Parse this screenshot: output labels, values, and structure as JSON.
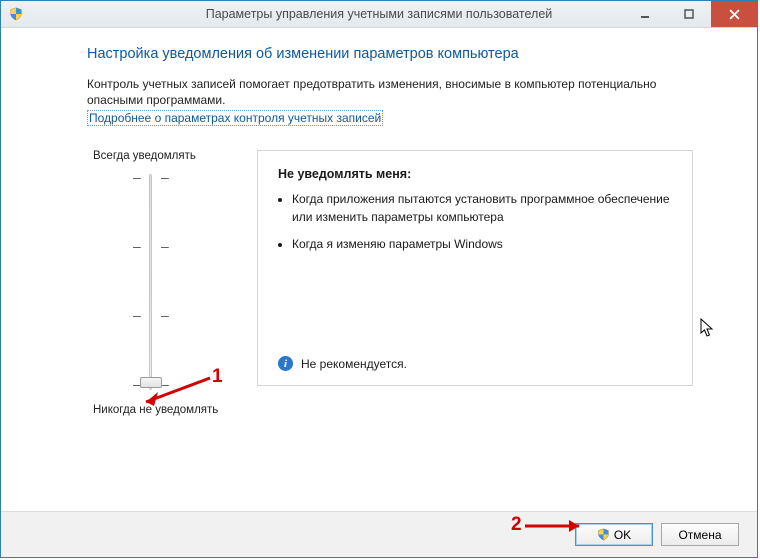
{
  "window": {
    "title": "Параметры управления учетными записями пользователей"
  },
  "heading": "Настройка уведомления об изменении параметров компьютера",
  "description": "Контроль учетных записей помогает предотвратить изменения, вносимые в компьютер потенциально опасными программами.",
  "link": "Подробнее о параметрах контроля учетных записей",
  "slider": {
    "top_label": "Всегда уведомлять",
    "bottom_label": "Никогда не уведомлять",
    "levels": 4,
    "position": 0
  },
  "panel": {
    "title": "Не уведомлять меня:",
    "items": [
      "Когда приложения пытаются установить программное обеспечение или изменить параметры компьютера",
      "Когда я изменяю параметры Windows"
    ],
    "recommend": "Не рекомендуется."
  },
  "footer": {
    "ok": "OK",
    "cancel": "Отмена"
  },
  "annotations": {
    "n1": "1",
    "n2": "2"
  }
}
